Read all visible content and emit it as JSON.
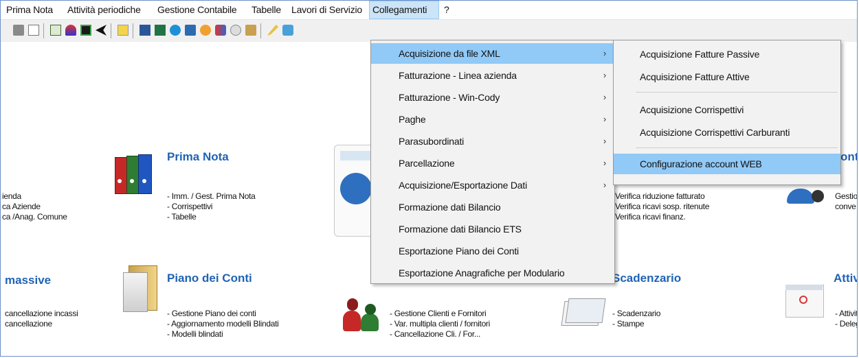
{
  "menubar": {
    "items": [
      "Prima Nota",
      "Attività periodiche",
      "Gestione Contabile",
      "Tabelle",
      "Lavori di Servizio",
      "Collegamenti",
      "?"
    ]
  },
  "toolbar": {
    "icons": [
      "print-icon",
      "print-preview-icon",
      "calculator-icon",
      "runner-icon",
      "book-icon",
      "arrow-icon",
      "help-doc-icon",
      "word-icon",
      "excel-icon",
      "ie-icon",
      "monitor-icon",
      "globe-icon",
      "people-icon",
      "dt-icon",
      "scanner-icon",
      "pencil-help-icon",
      "tool-icon"
    ]
  },
  "desktop": {
    "left_col": {
      "lines_top": [
        "ienda",
        "ca Aziende",
        "ca /Anag. Comune"
      ],
      "title": "massive",
      "lines_bottom": [
        "cancellazione incassi",
        "cancellazione"
      ]
    },
    "prima_nota": {
      "title": "Prima Nota",
      "lines": [
        "- Imm. / Gest. Prima Nota",
        "- Corrispettivi",
        "- Tabelle"
      ]
    },
    "piano_conti": {
      "title": "Piano dei Conti",
      "lines": [
        "- Gestione Piano dei conti",
        "- Aggiornamento modelli Blindati",
        "- Modelli blindati"
      ]
    },
    "clienti": {
      "lines": [
        "- Gestione Clienti e Fornitori",
        "- Var. multipla clienti / fornitori",
        "- Cancellazione Cli. / For..."
      ]
    },
    "verifica": {
      "lines": [
        "Verifica riduzione fatturato",
        "Verifica ricavi sosp. ritenute",
        "Verifica ricavi finanz."
      ]
    },
    "scadenzario": {
      "title": "Scadenzario",
      "lines": [
        "- Scadenzario",
        "- Stampe"
      ]
    },
    "right_top": {
      "title": "ont",
      "lines": [
        "Gestio",
        "conve"
      ]
    },
    "right_bottom": {
      "title": "Attivi",
      "lines": [
        "- Attivit",
        "- Deleg"
      ]
    }
  },
  "collegamenti_menu": {
    "items": [
      {
        "label": "Acquisizione da file XML",
        "submenu": true
      },
      {
        "label": "Fatturazione - Linea azienda",
        "submenu": true
      },
      {
        "label": "Fatturazione -  Win-Cody",
        "submenu": true
      },
      {
        "label": "Paghe",
        "submenu": true
      },
      {
        "label": "Parasubordinati",
        "submenu": true
      },
      {
        "label": "Parcellazione",
        "submenu": true
      },
      {
        "label": "Acquisizione/Esportazione Dati",
        "submenu": true
      },
      {
        "label": "Formazione dati Bilancio",
        "submenu": false
      },
      {
        "label": "Formazione dati Bilancio ETS",
        "submenu": false
      },
      {
        "label": "Esportazione Piano dei Conti",
        "submenu": false
      },
      {
        "label": "Esportazione Anagrafiche per Modulario",
        "submenu": false
      }
    ],
    "arrow": "›"
  },
  "xml_submenu": {
    "items": [
      "Acquisizione Fatture Passive",
      "Acquisizione Fatture Attive",
      "Acquisizione Corrispettivi",
      "Acquisizione Corrispettivi Carburanti",
      "Configurazione account WEB"
    ]
  },
  "colors": {
    "highlight": "#91c9f7",
    "title_blue": "#1f63b5",
    "menubar_active": "#cce4f7"
  }
}
